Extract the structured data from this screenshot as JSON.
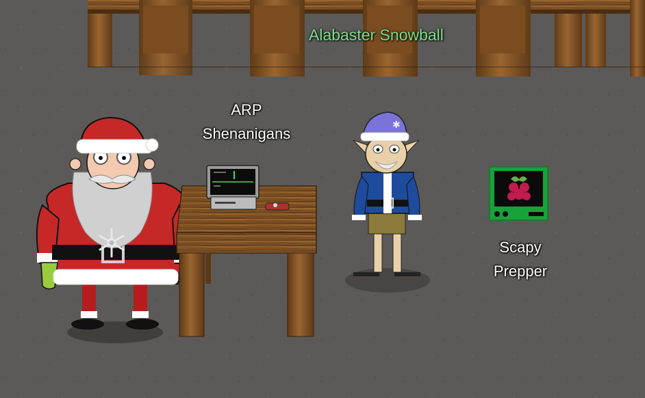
{
  "npc": {
    "name": "Alabaster Snowball"
  },
  "terminals": [
    {
      "line1": "ARP",
      "line2": "Shenanigans"
    },
    {
      "line1": "Scapy",
      "line2": "Prepper"
    }
  ],
  "colors": {
    "npc_name": "#7ee08a",
    "floor": "#5b5a58",
    "wood": "#8a5a28",
    "terminal_green": "#17a23a"
  },
  "icons": [
    "raspberry-pi-icon",
    "snowflake-icon"
  ]
}
